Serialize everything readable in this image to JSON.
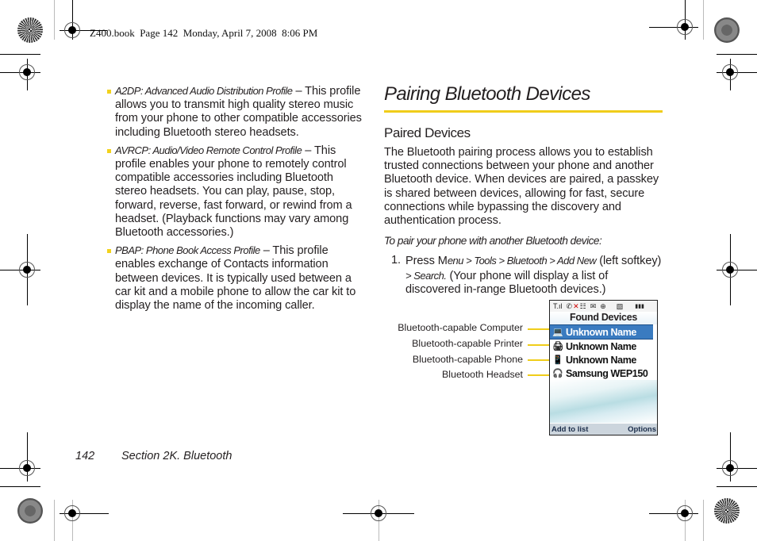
{
  "print_header": "Z400.book  Page 142  Monday, April 7, 2008  8:06 PM",
  "left_column": {
    "bullets": [
      {
        "term": "A2DP: Advanced Audio Distribution Profile",
        "dash": " – ",
        "text": "This profile allows you to transmit high quality stereo music from your phone to other compatible accessories including Bluetooth stereo headsets."
      },
      {
        "term": "AVRCP: Audio/Video Remote Control Profile",
        "dash": " – ",
        "text": "This profile enables your phone to remotely control compatible accessories including Bluetooth stereo headsets. You can play, pause, stop, forward, reverse, fast forward, or rewind from a headset. (Playback functions may vary among Bluetooth accessories.)"
      },
      {
        "term": "PBAP: Phone Book Access Profile",
        "dash": " – ",
        "text": "This profile enables exchange of Contacts information between devices. It is typically used between a car kit and a mobile phone to allow the car kit to display the name of the incoming caller."
      }
    ]
  },
  "right_column": {
    "section_title": "Pairing Bluetooth Devices",
    "subsection_title": "Paired Devices",
    "intro": "The Bluetooth pairing process allows you to establish trusted connections between your phone and another Bluetooth device. When devices are paired, a passkey is shared between devices, allowing for fast, secure connections while bypassing the discovery and authentication process.",
    "instruction": "To pair your phone with another Bluetooth device:",
    "step": {
      "number": "1.",
      "press": "Press M",
      "menu_path": "enu > Tools > Bluetooth > Add New",
      "mid": " (left softkey) ",
      "search": "> Search.",
      "tail": " (Your phone will display a list of discovered in-range Bluetooth devices.)"
    }
  },
  "figure": {
    "callouts": [
      "Bluetooth-capable Computer",
      "Bluetooth-capable Printer",
      "Bluetooth-capable Phone",
      "Bluetooth Headset"
    ],
    "phone_screen": {
      "status_icons": [
        "signal-icon",
        "roaming-icon",
        "ringer-off-icon",
        "menu-icon",
        "message-icon",
        "bluetooth-icon",
        "sim-icon",
        "battery-icon"
      ],
      "status_glyphs": [
        "T.ıl",
        "✆",
        "✕",
        "☷",
        "✉",
        "⊕",
        "▧",
        "▮▮▮"
      ],
      "title": "Found Devices",
      "devices": [
        {
          "name": "Unknown Name",
          "icon": "computer-icon",
          "glyph": "💻",
          "selected": true
        },
        {
          "name": "Unknown Name",
          "icon": "printer-icon",
          "glyph": "🖨",
          "selected": false
        },
        {
          "name": "Unknown Name",
          "icon": "phone-icon",
          "glyph": "📱",
          "selected": false
        },
        {
          "name": "Samsung WEP150",
          "icon": "headset-icon",
          "glyph": "🎧",
          "selected": false
        }
      ],
      "left_softkey": "Add to list",
      "right_softkey": "Options"
    }
  },
  "footer": {
    "page_number": "142",
    "section": "Section 2K. Bluetooth"
  },
  "colors": {
    "accent_yellow": "#f0cd1a",
    "selection_blue": "#3a7bc0",
    "text": "#231f20"
  }
}
